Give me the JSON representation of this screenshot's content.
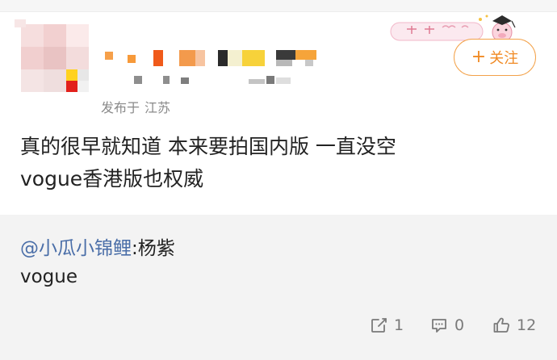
{
  "user": {
    "location_label": "发布于",
    "location_value": "江苏"
  },
  "follow_button": {
    "plus": "+",
    "label": "关注"
  },
  "post": {
    "line1": "真的很早就知道 本来要拍国内版 一直没空",
    "line2": "vogue香港版也权威"
  },
  "repost": {
    "mention": "@小瓜小锦鲤",
    "separator": ":",
    "target": "杨紫",
    "body": "vogue"
  },
  "actions": {
    "repost_count": "1",
    "comment_count": "0",
    "like_count": "12"
  },
  "colors": {
    "accent": "#f08a24",
    "mention": "#4a6ea8",
    "repost_bg": "#f3f3f3"
  },
  "icons": {
    "repost": "repost-icon",
    "comment": "comment-icon",
    "like": "thumbs-up-icon"
  }
}
